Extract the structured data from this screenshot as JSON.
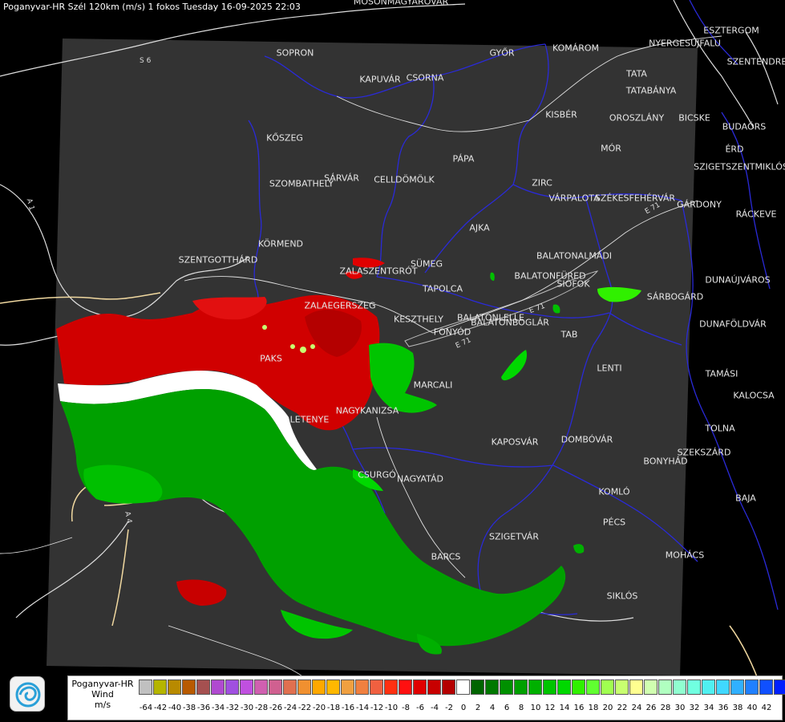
{
  "header": {
    "title": "Poganyvar-HR Szél 120km (m/s) 1 fokos Tuesday 16-09-2025 22:03"
  },
  "map": {
    "cities": [
      {
        "name": "MOSONMAGYARÓVÁR"
      },
      {
        "name": "SOPRON"
      },
      {
        "name": "GYŐR"
      },
      {
        "name": "KAPUVÁR"
      },
      {
        "name": "CSORNA"
      },
      {
        "name": "KOMÁROM"
      },
      {
        "name": "NYERGESÚJFALU"
      },
      {
        "name": "ESZTERGOM"
      },
      {
        "name": "SZENTENDRE"
      },
      {
        "name": "TATA"
      },
      {
        "name": "TATABÁNYA"
      },
      {
        "name": "KISBÉR"
      },
      {
        "name": "OROSZLÁNY"
      },
      {
        "name": "BICSKE"
      },
      {
        "name": "BUDAÖRS"
      },
      {
        "name": "ÉRD"
      },
      {
        "name": "SZIGETSZENTMIKLÓS"
      },
      {
        "name": "KŐSZEG"
      },
      {
        "name": "MÓR"
      },
      {
        "name": "PÁPA"
      },
      {
        "name": "SÁRVÁR"
      },
      {
        "name": "CELLDÖMÖLK"
      },
      {
        "name": "SZOMBATHELY"
      },
      {
        "name": "ZIRC"
      },
      {
        "name": "VÁRPALOTA"
      },
      {
        "name": "SZÉKESFEHÉRVÁR"
      },
      {
        "name": "GÁRDONY"
      },
      {
        "name": "RÁCKEVE"
      },
      {
        "name": "AJKA"
      },
      {
        "name": "KÖRMEND"
      },
      {
        "name": "SZENTGOTTHÁRD"
      },
      {
        "name": "SÜMEG"
      },
      {
        "name": "ZALASZENTGRÓT"
      },
      {
        "name": "BALATONALMÁDI"
      },
      {
        "name": "BALATONFÜRED"
      },
      {
        "name": "SIÓFOK"
      },
      {
        "name": "DUNAÚJVÁROS"
      },
      {
        "name": "TAPOLCA"
      },
      {
        "name": "SÁRBOGÁRD"
      },
      {
        "name": "ZALAEGERSZEG"
      },
      {
        "name": "KESZTHELY"
      },
      {
        "name": "BALATONLELLE"
      },
      {
        "name": "FONYÓD"
      },
      {
        "name": "BALATONBOGLÁR"
      },
      {
        "name": "DUNAFÖLDVÁR"
      },
      {
        "name": "TAB"
      },
      {
        "name": "LENTI"
      },
      {
        "name": "TAMÁSI"
      },
      {
        "name": "PAKS"
      },
      {
        "name": "MARCALI"
      },
      {
        "name": "KALOCSA"
      },
      {
        "name": "LETENYE"
      },
      {
        "name": "NAGYKANIZSA"
      },
      {
        "name": "TOLNA"
      },
      {
        "name": "KAPOSVÁR"
      },
      {
        "name": "DOMBÓVÁR"
      },
      {
        "name": "SZEKSZÁRD"
      },
      {
        "name": "BONYHÁD"
      },
      {
        "name": "CSURGÓ"
      },
      {
        "name": "NAGYATÁD"
      },
      {
        "name": "KOMLÓ"
      },
      {
        "name": "BAJA"
      },
      {
        "name": "PÉCS"
      },
      {
        "name": "SZIGETVÁR"
      },
      {
        "name": "BARCS"
      },
      {
        "name": "MOHÁCS"
      },
      {
        "name": "SIKLÓS"
      }
    ],
    "roads": [
      {
        "name": "S 6"
      },
      {
        "name": "A 1"
      },
      {
        "name": "E 71"
      },
      {
        "name": "E 71"
      },
      {
        "name": "E 71"
      },
      {
        "name": "A 4"
      }
    ]
  },
  "legend": {
    "station": "Poganyvar-HR",
    "quantity": "Wind",
    "unit": "m/s",
    "colors": [
      "#c0c0c0",
      "#b5b500",
      "#b88a00",
      "#b85a00",
      "#a55050",
      "#b04ad0",
      "#a050e0",
      "#c050e0",
      "#d060b0",
      "#d06090",
      "#e07050",
      "#f09030",
      "#ffa800",
      "#ffb800",
      "#f0a040",
      "#f08040",
      "#f06040",
      "#ff3010",
      "#ff1010",
      "#e00000",
      "#c80000",
      "#b40000",
      "#ffffff",
      "#006400",
      "#007800",
      "#009000",
      "#00a000",
      "#00b000",
      "#00c400",
      "#00d800",
      "#30f000",
      "#60ff30",
      "#a0ff50",
      "#c8ff70",
      "#ffff90",
      "#d0ffb0",
      "#b0ffc0",
      "#90ffd0",
      "#70ffe0",
      "#50f0f0",
      "#40d8ff",
      "#30b0ff",
      "#2080ff",
      "#1050ff",
      "#0020ff",
      "#0000ff"
    ],
    "ticks": [
      "-64",
      "-42",
      "-40",
      "-38",
      "-36",
      "-34",
      "-32",
      "-30",
      "-28",
      "-26",
      "-24",
      "-22",
      "-20",
      "-18",
      "-16",
      "-14",
      "-12",
      "-10",
      "-8",
      "-6",
      "-4",
      "-2",
      "0",
      "2",
      "4",
      "6",
      "8",
      "10",
      "12",
      "14",
      "16",
      "18",
      "20",
      "22",
      "24",
      "26",
      "28",
      "30",
      "32",
      "34",
      "36",
      "38",
      "40",
      "42"
    ]
  }
}
